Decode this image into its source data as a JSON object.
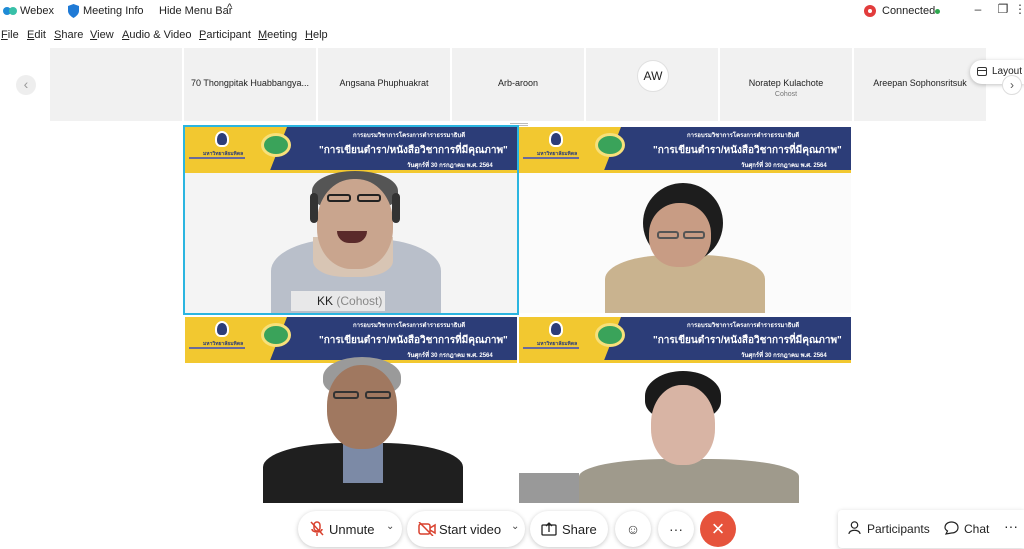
{
  "titlebar": {
    "app_name": "Webex",
    "meeting_info": "Meeting Info",
    "hide_menu_bar": "Hide Menu Bar",
    "status": "Connected",
    "status_color": "#e23c3c",
    "connected_dot_color": "#2fa84f"
  },
  "menu": [
    "File",
    "Edit",
    "Share",
    "View",
    "Audio & Video",
    "Participant",
    "Meeting",
    "Help"
  ],
  "filmstrip": {
    "participants": [
      {
        "name": "",
        "role": ""
      },
      {
        "name": "70 Thongpitak Huabbangya...",
        "role": ""
      },
      {
        "name": "Angsana Phuphuakrat",
        "role": ""
      },
      {
        "name": "Arb-aroon",
        "role": ""
      },
      {
        "name": "",
        "role": "",
        "initials": "AW"
      },
      {
        "name": "Noratep Kulachote",
        "role": "Cohost"
      },
      {
        "name": "Areepan Sophonsritsuk",
        "role": ""
      }
    ],
    "layout_label": "Layout"
  },
  "banner": {
    "line1": "การอบรมวิชาการโครงการตำราธรรมาธิบดี",
    "line2": "\"การเขียนตำรา/หนังสือวิชาการที่มีคุณภาพ\"",
    "line3": "วันศุกร์ที่ 30 กรกฎาคม พ.ศ. 2564",
    "university": "มหาวิทยาลัยมหิดล"
  },
  "active_speaker": {
    "name": "KK",
    "role": "(Cohost)",
    "highlight_color": "#2bb5e0"
  },
  "toolbar": {
    "unmute": "Unmute",
    "start_video": "Start video",
    "share": "Share",
    "reactions_icon": "☺",
    "more_icon": "···",
    "leave_icon": "×",
    "participants": "Participants",
    "chat": "Chat",
    "right_more_icon": "···",
    "leave_color": "#e6533c"
  },
  "icons": {
    "window_minimize": "–",
    "window_restore": "❐",
    "window_more": "⋮",
    "caret_up": "^",
    "prev": "‹",
    "next": "›"
  }
}
